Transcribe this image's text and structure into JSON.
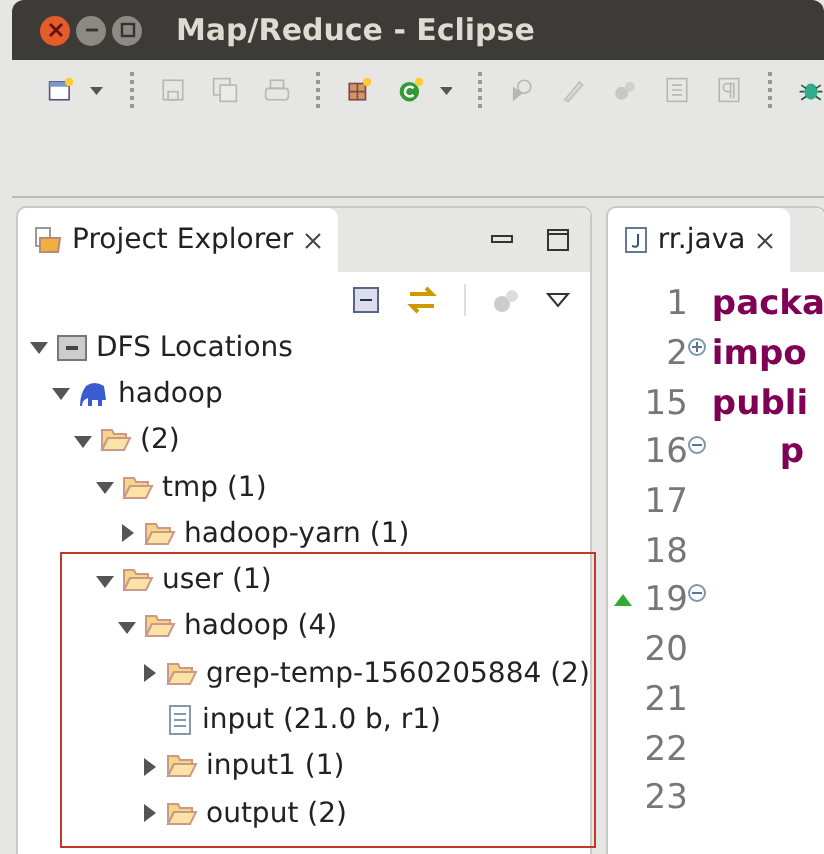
{
  "window": {
    "title": "Map/Reduce - Eclipse"
  },
  "toolbar": [
    {
      "kind": "new-window",
      "disabled": false
    },
    {
      "kind": "caret",
      "disabled": false
    },
    {
      "kind": "sep"
    },
    {
      "kind": "save",
      "disabled": true
    },
    {
      "kind": "save-all",
      "disabled": true
    },
    {
      "kind": "print",
      "disabled": true
    },
    {
      "kind": "sep"
    },
    {
      "kind": "new-grid",
      "disabled": false
    },
    {
      "kind": "new-class",
      "disabled": false
    },
    {
      "kind": "caret",
      "disabled": false
    },
    {
      "kind": "sep"
    },
    {
      "kind": "run-gear",
      "disabled": true
    },
    {
      "kind": "pen",
      "disabled": true
    },
    {
      "kind": "balls",
      "disabled": true
    },
    {
      "kind": "page",
      "disabled": true
    },
    {
      "kind": "pilcrow",
      "disabled": true
    },
    {
      "kind": "sep"
    },
    {
      "kind": "bug",
      "disabled": false
    }
  ],
  "explorer": {
    "tab": {
      "label": "Project Explorer",
      "selected": true
    },
    "tree": [
      {
        "kind": "server",
        "label": "DFS Locations",
        "expanded": true,
        "children": [
          {
            "kind": "elephant",
            "label": "hadoop",
            "expanded": true,
            "children": [
              {
                "kind": "folder",
                "label": "(2)",
                "expanded": true,
                "children": [
                  {
                    "kind": "folder",
                    "label": "tmp (1)",
                    "expanded": true,
                    "children": [
                      {
                        "kind": "folder",
                        "label": "hadoop-yarn (1)",
                        "expanded": false
                      }
                    ]
                  },
                  {
                    "kind": "folder",
                    "label": "user (1)",
                    "expanded": true,
                    "children": [
                      {
                        "kind": "folder",
                        "label": "hadoop (4)",
                        "expanded": true,
                        "children": [
                          {
                            "kind": "folder",
                            "label": "grep-temp-1560205884 (2)",
                            "expanded": false
                          },
                          {
                            "kind": "file",
                            "label": "input (21.0 b, r1)"
                          },
                          {
                            "kind": "folder",
                            "label": "input1 (1)",
                            "expanded": false
                          },
                          {
                            "kind": "folder",
                            "label": "output (2)",
                            "expanded": false
                          }
                        ]
                      }
                    ]
                  }
                ]
              }
            ]
          }
        ]
      }
    ]
  },
  "editor": {
    "tab": {
      "label": "rr.java",
      "selected": true
    },
    "lines": [
      {
        "number": "1",
        "code": "packa",
        "indent": false
      },
      {
        "number": "2",
        "code": "impo",
        "collapsed": true,
        "indent": false
      },
      {
        "number": "15",
        "code": "publi",
        "indent": false
      },
      {
        "number": "16",
        "code": "p",
        "collapsed": false,
        "indent": true
      },
      {
        "number": "17"
      },
      {
        "number": "18"
      },
      {
        "number": "19",
        "collapsed": false,
        "override": true
      },
      {
        "number": "20"
      },
      {
        "number": "21"
      },
      {
        "number": "22"
      },
      {
        "number": "23"
      }
    ]
  }
}
